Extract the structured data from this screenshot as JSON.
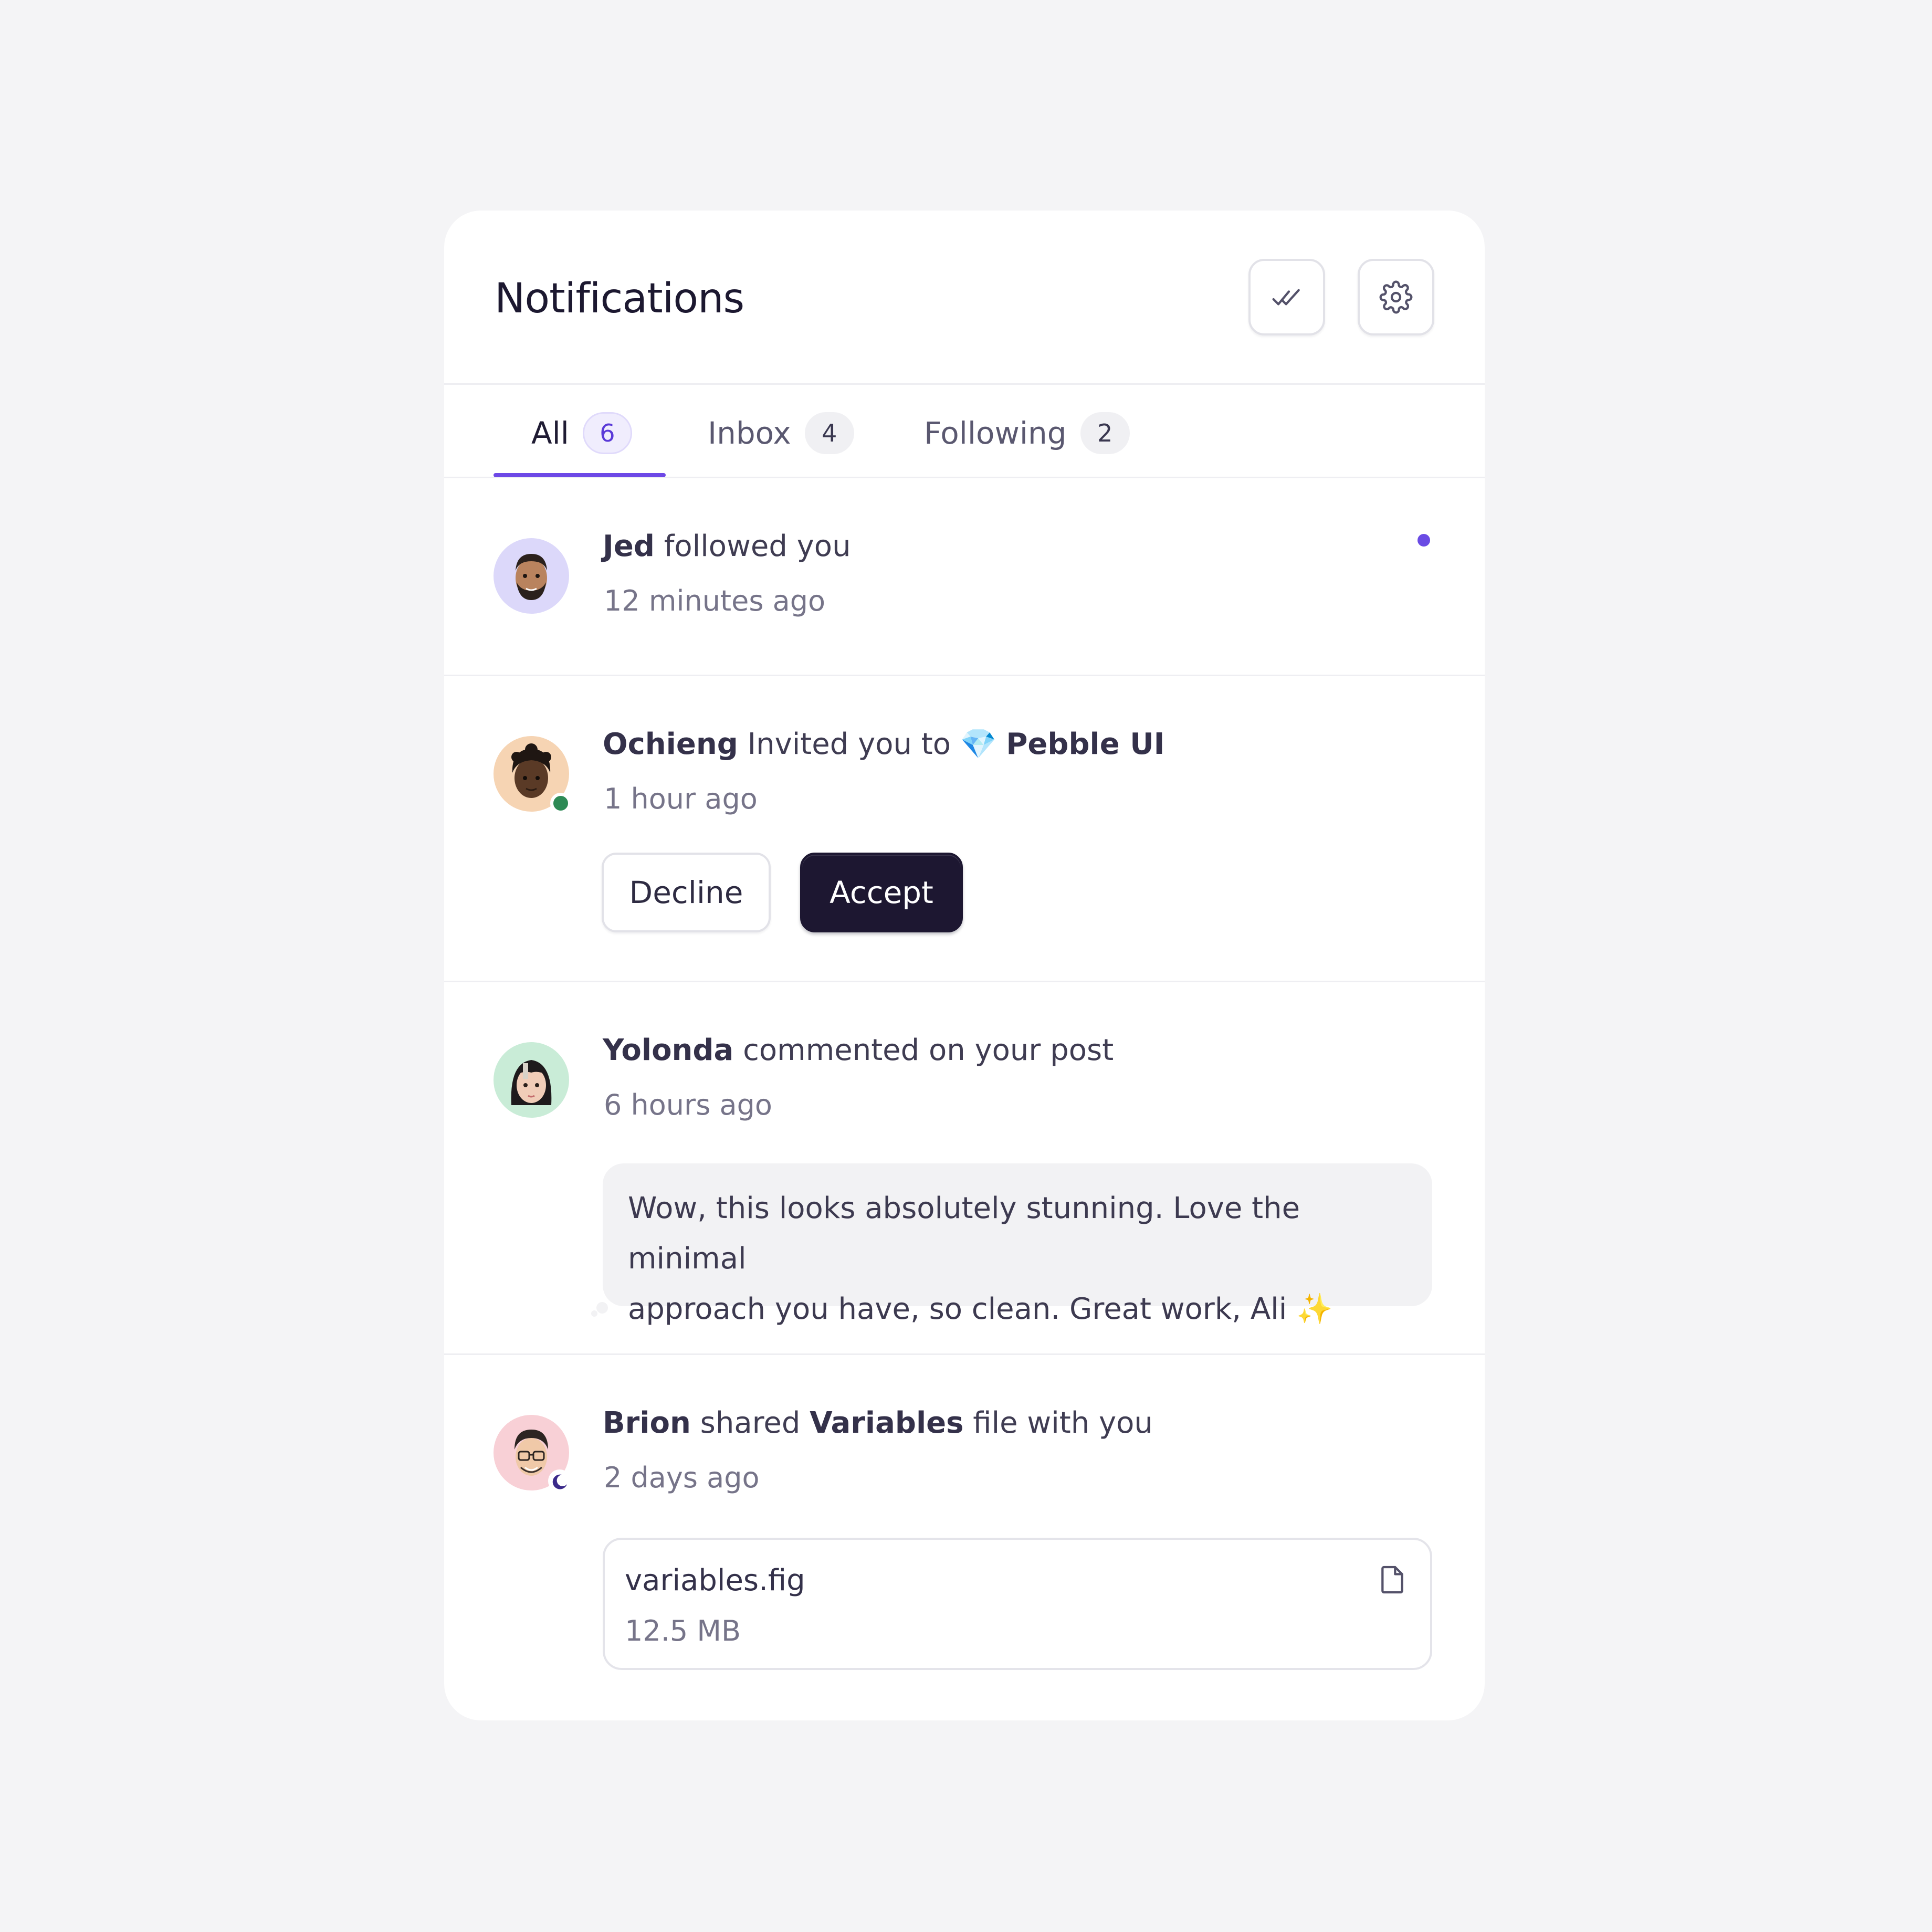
{
  "header": {
    "title": "Notifications",
    "mark_read_icon": "double-check-icon",
    "settings_icon": "gear-icon"
  },
  "tabs": [
    {
      "label": "All",
      "count": "6",
      "active": true
    },
    {
      "label": "Inbox",
      "count": "4",
      "active": false
    },
    {
      "label": "Following",
      "count": "2",
      "active": false
    }
  ],
  "notifications": [
    {
      "actor": "Jed",
      "text": " followed you",
      "time": "12 minutes ago",
      "unread": true
    },
    {
      "actor": "Ochieng",
      "text": " Invited you to ",
      "emoji": "💎",
      "target": "Pebble UI",
      "time": "1 hour ago",
      "status": "online",
      "decline_label": "Decline",
      "accept_label": "Accept"
    },
    {
      "actor": "Yolonda",
      "text": " commented on your post",
      "time": "6 hours ago",
      "comment_line1": "Wow, this looks absolutely stunning. Love the minimal",
      "comment_line2": "approach you have, so clean. Great work, Ali ",
      "comment_emoji": "✨"
    },
    {
      "actor": "Brion",
      "text1": " shared ",
      "target": "Variables",
      "text2": " file with you",
      "time": "2 days ago",
      "status": "away",
      "file_name": "variables.fig",
      "file_size": "12.5 MB",
      "file_icon": "file-icon"
    }
  ],
  "colors": {
    "accent": "#6d48e6",
    "online": "#2d8a55",
    "away": "#3b2a8a",
    "accept_bg": "#1d1731"
  }
}
